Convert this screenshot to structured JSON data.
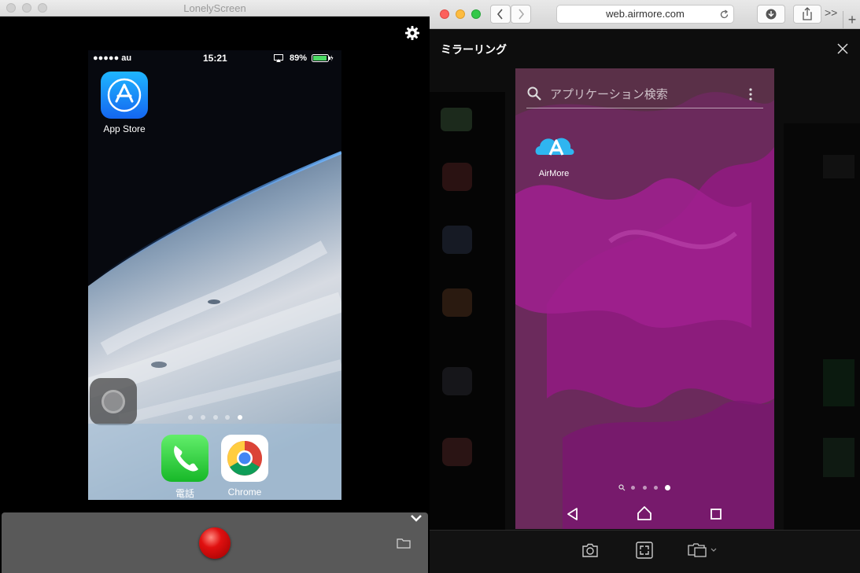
{
  "lonelyscreen": {
    "title": "LonelyScreen",
    "accent_record": "#e01010"
  },
  "iphone": {
    "status": {
      "signal": "●●●●● au",
      "time": "15:21",
      "battery": "89%"
    },
    "apps": [
      {
        "label": "App Store",
        "icon": "app-store-icon"
      }
    ],
    "dock": [
      {
        "label": "電話",
        "icon": "phone-icon"
      },
      {
        "label": "Chrome",
        "icon": "chrome-icon"
      }
    ],
    "page_count": 5,
    "current_page": 5
  },
  "safari": {
    "address": "web.airmore.com",
    "more": ">>",
    "plus": "+"
  },
  "airmore": {
    "header": "ミラーリング",
    "android": {
      "search_placeholder": "アプリケーション検索",
      "apps": [
        {
          "label": "AirMore",
          "icon": "airmore-icon"
        }
      ],
      "page_count": 4,
      "current_page": 4
    },
    "tools": [
      "screenshot-icon",
      "fullscreen-icon",
      "screen-mode-icon"
    ]
  }
}
